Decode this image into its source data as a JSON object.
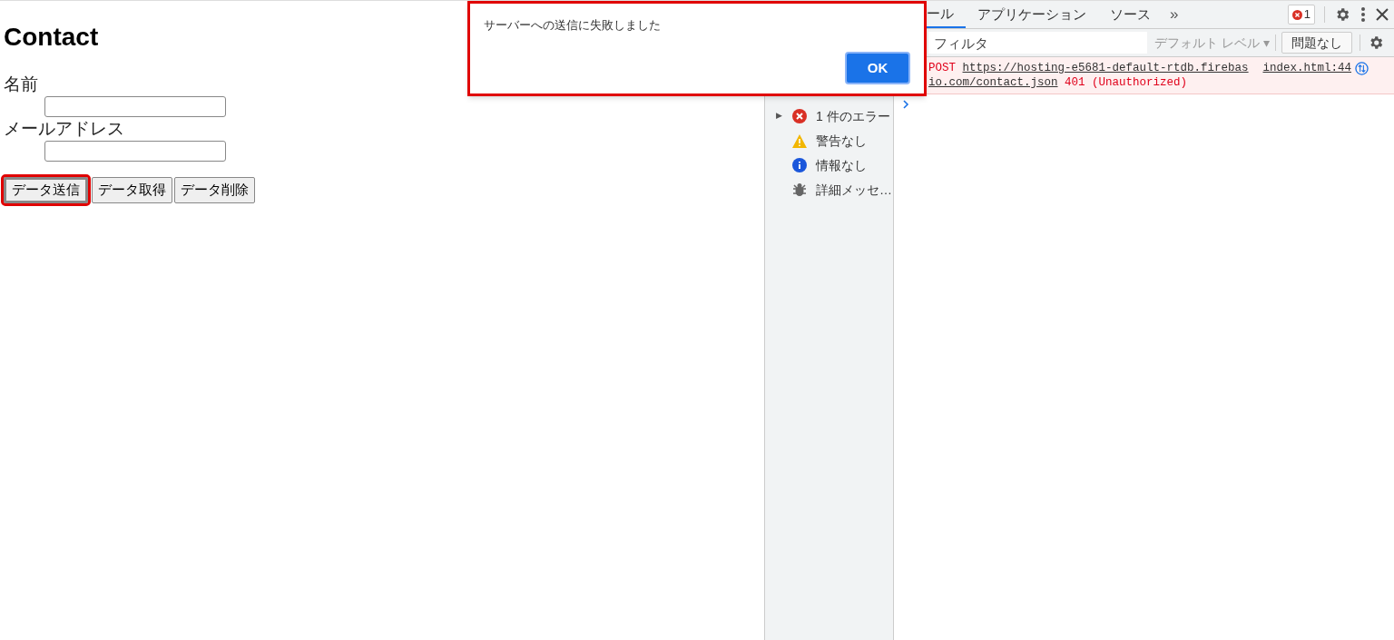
{
  "page": {
    "heading": "Contact",
    "fields": [
      {
        "label": "名前"
      },
      {
        "label": "メールアドレス"
      }
    ],
    "buttons": [
      {
        "label": "データ送信",
        "highlighted": true
      },
      {
        "label": "データ取得",
        "highlighted": false
      },
      {
        "label": "データ削除",
        "highlighted": false
      }
    ]
  },
  "dialog": {
    "message": "サーバーへの送信に失敗しました",
    "button": "OK",
    "highlighted": true
  },
  "devtools": {
    "tabs": [
      {
        "label": "ール",
        "selected": true
      },
      {
        "label": "アプリケーション",
        "selected": false
      },
      {
        "label": "ソース",
        "selected": false
      }
    ],
    "more": "»",
    "error_count": "1",
    "filter": {
      "placeholder": "フィルタ"
    },
    "level_menu": "デフォルト レベル ▾",
    "issues": "問題なし",
    "sidebar": [
      {
        "kind": "error",
        "label": "1 件のエラー",
        "arrow": "▶"
      },
      {
        "kind": "warning",
        "label": "警告なし"
      },
      {
        "kind": "info",
        "label": "情報なし"
      },
      {
        "kind": "verbose",
        "label": "詳細メッセ…"
      }
    ],
    "messages": [
      {
        "method": "POST",
        "url": "https://hosting-e5681-default-rtdb.firebas",
        "url_cont": "io.com/contact.json",
        "status": "401 (Unauthorized)",
        "source": "index.html:44"
      }
    ]
  }
}
